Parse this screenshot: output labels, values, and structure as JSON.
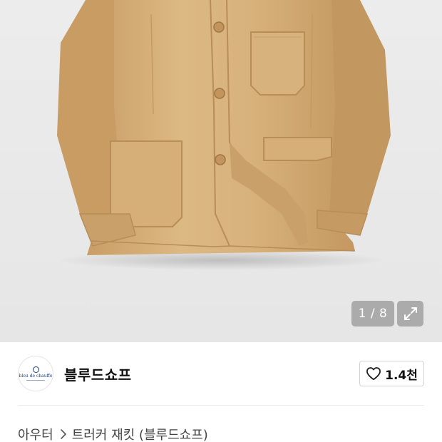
{
  "gallery": {
    "image": "beige-work-jacket-photo",
    "counter": "1 / 8",
    "current_index": 1,
    "total_images": 8,
    "expand_icon": "expand-arrows-icon"
  },
  "shop": {
    "logo_text": "bleu de chauffe",
    "name": "블루드쇼프",
    "like_icon": "heart-outline-icon",
    "like_count": "1.4천"
  },
  "breadcrumb": {
    "category": "아우터",
    "separator_icon": "chevron-right-icon",
    "product": "트러커 재킷 (블루드쇼프)"
  },
  "colors": {
    "jacket": "#d9b47f",
    "background": "#e9e9e9",
    "badge": "#a0a0a0",
    "logo_blue": "#1d3a7a"
  }
}
